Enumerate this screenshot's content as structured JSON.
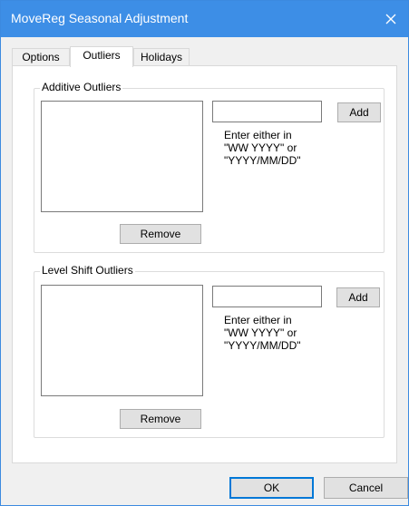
{
  "window": {
    "title": "MoveReg Seasonal Adjustment",
    "close_icon": "close-icon"
  },
  "tabs": [
    {
      "label": "Options",
      "active": false
    },
    {
      "label": "Outliers",
      "active": true
    },
    {
      "label": "Holidays",
      "active": false
    }
  ],
  "additive": {
    "group_label": "Additive Outliers",
    "list_items": [],
    "input_value": "",
    "add_label": "Add",
    "hint_lines": [
      "Enter either in",
      "\"WW YYYY\" or",
      "\"YYYY/MM/DD\""
    ],
    "remove_label": "Remove"
  },
  "level_shift": {
    "group_label": "Level Shift Outliers",
    "list_items": [],
    "input_value": "",
    "add_label": "Add",
    "hint_lines": [
      "Enter either in",
      "\"WW YYYY\" or",
      "\"YYYY/MM/DD\""
    ],
    "remove_label": "Remove"
  },
  "footer": {
    "ok_label": "OK",
    "cancel_label": "Cancel"
  },
  "colors": {
    "titlebar": "#3d8ee6",
    "dialog_bg": "#f0f0f0",
    "panel_bg": "#ffffff",
    "button_bg": "#e1e1e1",
    "default_button_border": "#0078d7"
  }
}
